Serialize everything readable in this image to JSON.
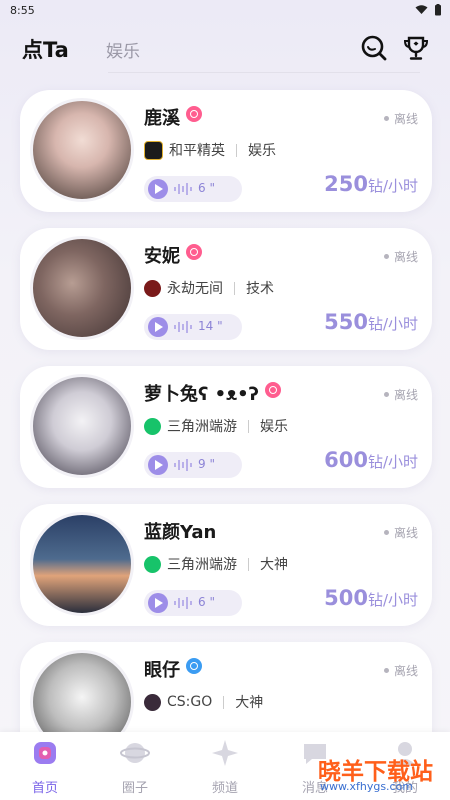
{
  "status_bar": {
    "time": "8:55"
  },
  "header": {
    "tab_active": "点Ta",
    "tab_other": "娱乐",
    "search_icon": "search-icon",
    "trophy_icon": "trophy-icon"
  },
  "cards": [
    {
      "name": "鹿溪",
      "gender": "female",
      "status": "离线",
      "game": "和平精英",
      "category": "娱乐",
      "duration": "6 \"",
      "price": "250",
      "unit": "钻/小时",
      "avatar_color": "#caa7a2"
    },
    {
      "name": "安妮",
      "gender": "female",
      "status": "离线",
      "game": "永劫无间",
      "category": "技术",
      "duration": "14 \"",
      "price": "550",
      "unit": "钻/小时",
      "avatar_color": "#6b5754"
    },
    {
      "name": "萝卜兔ʕ •ᴥ•ʔ",
      "gender": "female",
      "status": "离线",
      "game": "三角洲端游",
      "category": "娱乐",
      "duration": "9 \"",
      "price": "600",
      "unit": "钻/小时",
      "avatar_color": "#d8d6dc"
    },
    {
      "name": "蓝颜Yan",
      "gender": "",
      "status": "离线",
      "game": "三角洲端游",
      "category": "大神",
      "duration": "6 \"",
      "price": "500",
      "unit": "钻/小时",
      "avatar_color": "#2d4664"
    },
    {
      "name": "眼仔",
      "gender": "male",
      "status": "离线",
      "game": "CS:GO",
      "category": "大神",
      "duration": "",
      "price": "",
      "unit": "",
      "avatar_color": "#b8b8b8"
    }
  ],
  "nav": [
    {
      "label": "首页",
      "icon": "home-icon",
      "active": true
    },
    {
      "label": "圈子",
      "icon": "planet-icon",
      "active": false
    },
    {
      "label": "频道",
      "icon": "sparkle-icon",
      "active": false
    },
    {
      "label": "消息",
      "icon": "message-icon",
      "active": false
    },
    {
      "label": "我的",
      "icon": "profile-icon",
      "active": false
    }
  ],
  "watermark": {
    "title": "晓羊下载站",
    "url": "www.xfhygs.com"
  }
}
